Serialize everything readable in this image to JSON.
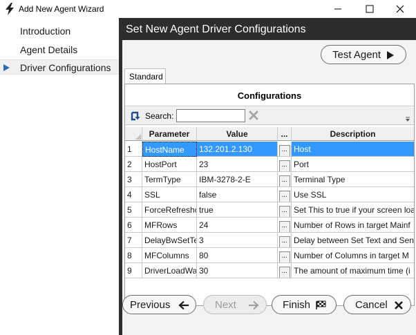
{
  "window": {
    "title": "Add New Agent Wizard"
  },
  "sidebar": {
    "items": [
      {
        "label": "Introduction"
      },
      {
        "label": "Agent Details"
      },
      {
        "label": "Driver Configurations",
        "selected": true
      }
    ]
  },
  "main": {
    "header_title": "Set New Agent Driver Configurations",
    "test_button": "Test Agent",
    "tab_label": "Standard",
    "config_title": "Configurations",
    "search_label": "Search:",
    "search_value": "",
    "columns": [
      "Parameter",
      "Value",
      "...",
      "Description"
    ],
    "rows": [
      {
        "index": "1",
        "parameter": "HostName",
        "value": "132.201.2.130",
        "description": "Host",
        "selected": true
      },
      {
        "index": "2",
        "parameter": "HostPort",
        "value": "23",
        "description": "Port"
      },
      {
        "index": "3",
        "parameter": "TermType",
        "value": "IBM-3278-2-E",
        "description": "Terminal Type"
      },
      {
        "index": "4",
        "parameter": "SSL",
        "value": "false",
        "description": "Use SSL"
      },
      {
        "index": "5",
        "parameter": "ForceRefreshc",
        "value": "true",
        "description": "Set This to true if your screen loa"
      },
      {
        "index": "6",
        "parameter": "MFRows",
        "value": "24",
        "description": "Number of Rows in target Mainf"
      },
      {
        "index": "7",
        "parameter": "DelayBwSetTe",
        "value": "3",
        "description": "Delay between Set Text and Senc"
      },
      {
        "index": "8",
        "parameter": "MFColumns",
        "value": "80",
        "description": "Number of Columns in target M"
      },
      {
        "index": "9",
        "parameter": "DriverLoadWa",
        "value": "30",
        "description": "The amount of maximum time (i"
      }
    ],
    "dots_label": "..."
  },
  "footer": {
    "previous": "Previous",
    "next": "Next",
    "finish": "Finish",
    "cancel": "Cancel"
  },
  "colors": {
    "header_bg": "#2d2d30",
    "selection": "#3399ff",
    "accent_arrow": "#2b6cb0"
  }
}
